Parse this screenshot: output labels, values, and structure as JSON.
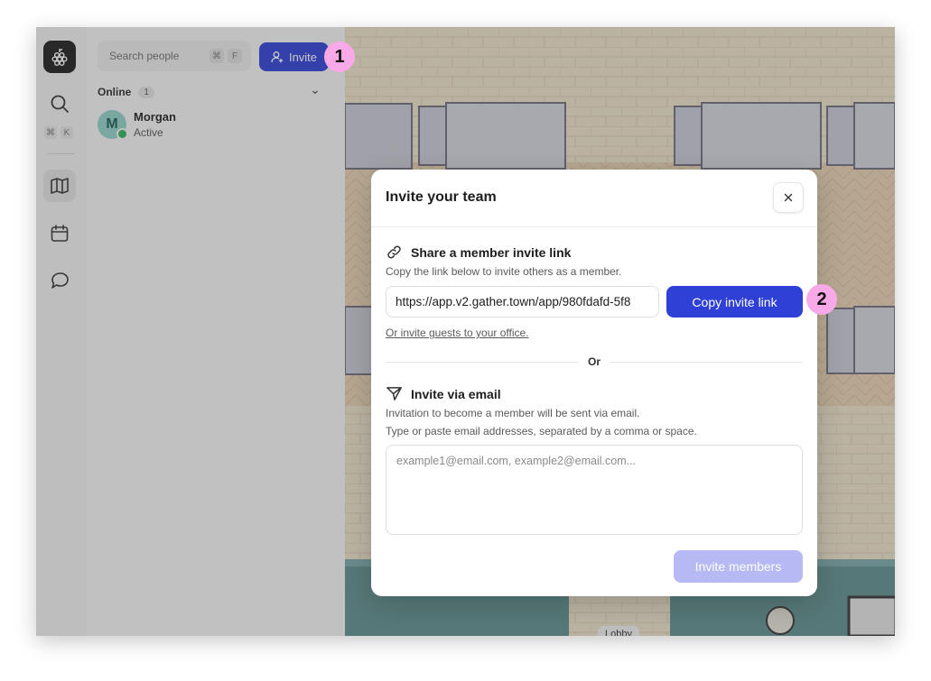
{
  "sidebar": {
    "shortcut_keys": [
      "⌘",
      "K"
    ],
    "items": [
      {
        "name": "search",
        "icon": "search-icon"
      },
      {
        "name": "map",
        "icon": "map-icon",
        "active": true
      },
      {
        "name": "calendar",
        "icon": "calendar-icon"
      },
      {
        "name": "chat",
        "icon": "chat-icon"
      }
    ]
  },
  "people_panel": {
    "search_placeholder": "Search people",
    "search_shortcut": [
      "⌘",
      "F"
    ],
    "invite_label": "Invite",
    "online_label": "Online",
    "online_count": "1",
    "members": [
      {
        "initial": "M",
        "name": "Morgan",
        "status": "Active"
      }
    ]
  },
  "steps": [
    "1",
    "2"
  ],
  "map": {
    "lobby_label": "Lobby"
  },
  "modal": {
    "title": "Invite your team",
    "link_section": {
      "title": "Share a member invite link",
      "description": "Copy the link below to invite others as a member.",
      "link_value": "https://app.v2.gather.town/app/980fdafd-5f8",
      "copy_label": "Copy invite link",
      "guest_link": "Or invite guests to your office."
    },
    "or_label": "Or",
    "email_section": {
      "title": "Invite via email",
      "description_1": "Invitation to become a member will be sent via email.",
      "description_2": "Type or paste email addresses, separated by a comma or space.",
      "placeholder": "example1@email.com, example2@email.com...",
      "submit_label": "Invite members"
    }
  },
  "colors": {
    "accent": "#2e40d6",
    "accent_disabled": "#b6b9f4",
    "step_badge": "#f9a8e8",
    "online_dot": "#2cb25a"
  }
}
